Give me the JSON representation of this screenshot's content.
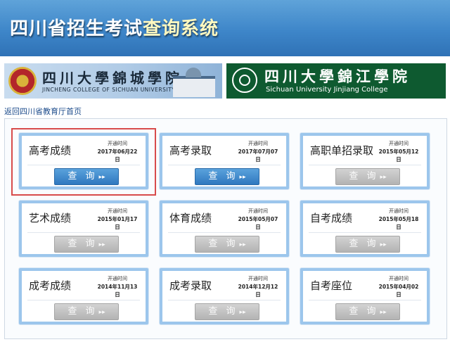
{
  "header": {
    "title_part1": "四川省招生考试",
    "title_part2": "查询系统"
  },
  "banners": {
    "left": {
      "cn": "四川大學錦城學院",
      "en": "JINCHENG COLLEGE OF SICHUAN UNIVERSITY"
    },
    "right": {
      "cn": "四川大學錦江學院",
      "en": "Sichuan University Jinjiang College"
    }
  },
  "back_link": "返回四川省教育厅首页",
  "open_time_label": "开通时间",
  "query_button_label": "查 询",
  "query_arrow": "▸▸",
  "colors": {
    "header_blue": "#3e86c9",
    "active_button": "#2f78bf",
    "inactive_button": "#b3b3b3",
    "highlight_red": "#d84b4b",
    "right_banner_green": "#0e5a30"
  },
  "cards": [
    {
      "title": "高考成绩",
      "date": "2017年06月22日",
      "active": true,
      "highlighted": true
    },
    {
      "title": "高考录取",
      "date": "2017年07月07日",
      "active": true
    },
    {
      "title": "高职单招录取",
      "date": "2015年05月12日",
      "active": false
    },
    {
      "title": "艺术成绩",
      "date": "2015年01月17日",
      "active": false
    },
    {
      "title": "体育成绩",
      "date": "2015年05月07日",
      "active": false
    },
    {
      "title": "自考成绩",
      "date": "2015年05月18日",
      "active": false
    },
    {
      "title": "成考成绩",
      "date": "2014年11月13日",
      "active": false
    },
    {
      "title": "成考录取",
      "date": "2014年12月12日",
      "active": false
    },
    {
      "title": "自考座位",
      "date": "2015年04月02日",
      "active": false
    }
  ]
}
